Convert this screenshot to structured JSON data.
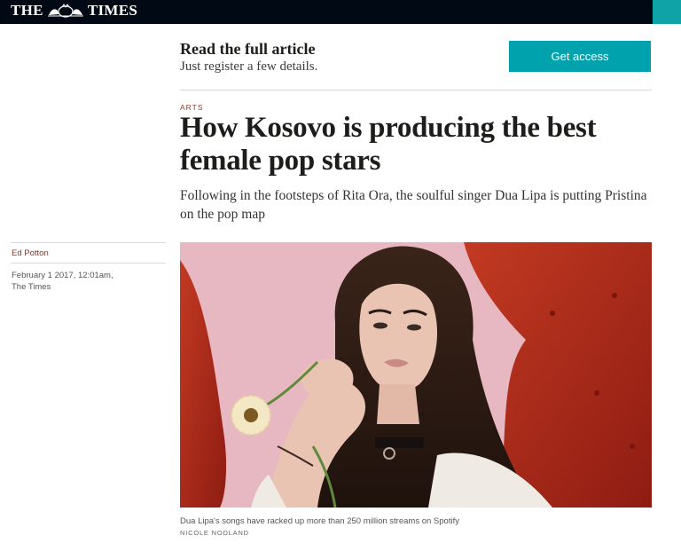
{
  "masthead": {
    "logo_left": "THE",
    "logo_right": "TIMES",
    "logo_crest_icon": "royal-crest-icon"
  },
  "register": {
    "title": "Read the full article",
    "subtitle": "Just register a few details.",
    "button_label": "Get access"
  },
  "article": {
    "section": "ARTS",
    "headline": "How Kosovo is producing the best female pop stars",
    "standfirst": "Following in the footsteps of Rita Ora, the soulful singer Dua Lipa is putting Pristina on the pop map",
    "author": "Ed Potton",
    "date_line": "February 1 2017, 12:01am,",
    "publication": "The Times"
  },
  "photo": {
    "caption": "Dua Lipa's songs have racked up more than 250 million streams on Spotify",
    "credit": "NICOLE NODLAND",
    "colors": {
      "background_pink": "#e8b8c2",
      "chair_red": "#b5261a",
      "hair": "#2a1a14",
      "skin": "#e9c4b3",
      "flower": "#f3e7c4"
    }
  },
  "colors": {
    "masthead_bg": "#010a14",
    "accent_teal": "#00a3ad",
    "section_label": "#8a3b2d"
  }
}
